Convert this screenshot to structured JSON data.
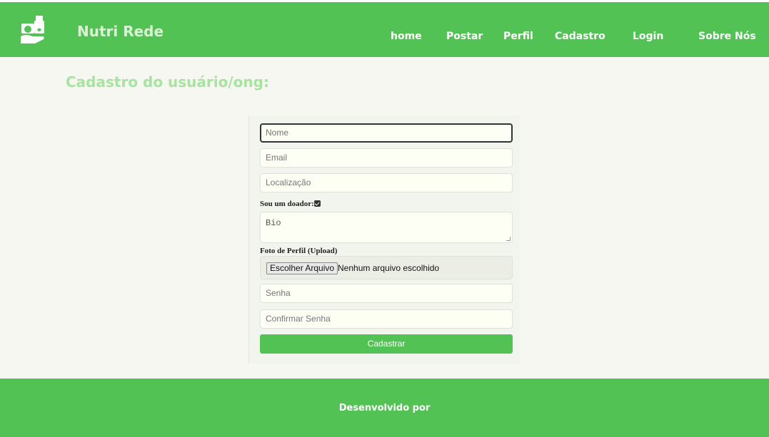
{
  "navbar": {
    "brand": "Nutri Rede",
    "logo_icon": "hand-holding-groceries-icon",
    "links": [
      "home",
      "Postar",
      "Perfil",
      "Cadastro",
      "Login",
      "Sobre Nós"
    ]
  },
  "page": {
    "title": "Cadastro do usuário/ong:"
  },
  "form": {
    "nome_placeholder": "Nome",
    "email_placeholder": "Email",
    "localizacao_placeholder": "Localização",
    "doador_label": "Sou um doador:",
    "doador_checked": true,
    "bio_placeholder": "Bio",
    "foto_label": "Foto de Perfil (Upload)",
    "file_button_label": "Escolher Arquivo",
    "file_status": "Nenhum arquivo escolhido",
    "senha_placeholder": "Senha",
    "confirmar_senha_placeholder": "Confirmar Senha",
    "submit_label": "Cadastrar"
  },
  "footer": {
    "text": "Desenvolvido por"
  },
  "colors": {
    "primary_green": "#52c255",
    "title_green": "#a7e3a1",
    "background": "#f5f7f0"
  }
}
